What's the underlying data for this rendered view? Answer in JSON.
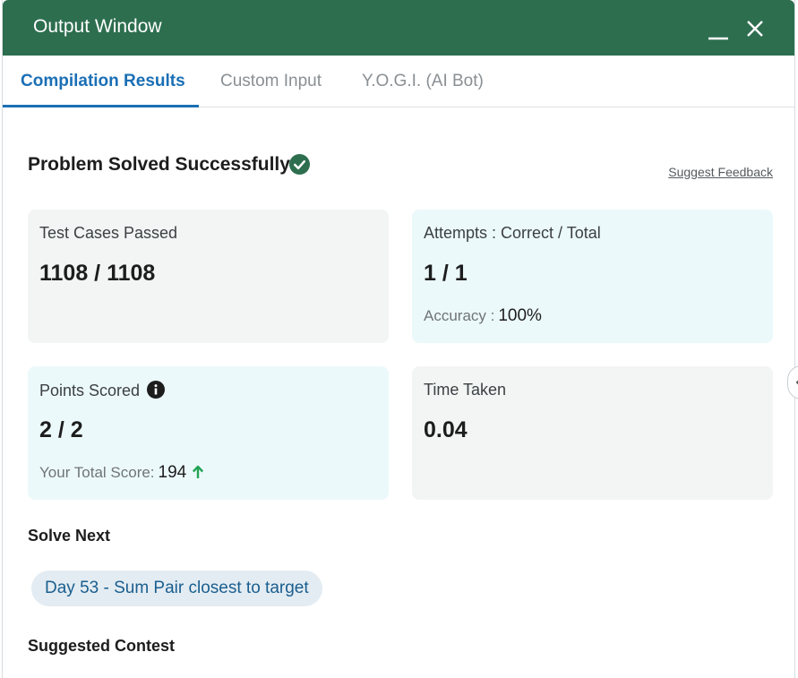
{
  "window": {
    "title": "Output Window"
  },
  "tabs": [
    {
      "label": "Compilation Results",
      "active": true
    },
    {
      "label": "Custom Input",
      "active": false
    },
    {
      "label": "Y.O.G.I. (AI Bot)",
      "active": false
    }
  ],
  "result": {
    "heading": "Problem Solved Successfully",
    "feedback_link": "Suggest Feedback"
  },
  "cards": {
    "test_cases": {
      "label": "Test Cases Passed",
      "value": "1108 / 1108"
    },
    "attempts": {
      "label": "Attempts : Correct / Total",
      "value": "1 / 1",
      "sub_label": "Accuracy :",
      "sub_value": "100%"
    },
    "points": {
      "label": "Points Scored",
      "value": "2 / 2",
      "sub_label": "Your Total Score:",
      "sub_value": "194"
    },
    "time": {
      "label": "Time Taken",
      "value": "0.04"
    }
  },
  "solve_next": {
    "title": "Solve Next",
    "item": "Day 53 - Sum Pair closest to target"
  },
  "suggested_contest": {
    "title": "Suggested Contest"
  },
  "icons": {
    "minimize": "minimize-icon",
    "close": "close-icon",
    "success": "check-circle-icon",
    "info": "info-icon",
    "trend": "arrow-up-icon",
    "collapse": "chevron-left-icon"
  },
  "colors": {
    "header_bg": "#2d6e4f",
    "accent": "#1a6fb5",
    "success": "#2d6e4f",
    "trend_up": "#23a454",
    "card_gray": "#f2f5f4",
    "card_blue": "#ecf9fb"
  }
}
